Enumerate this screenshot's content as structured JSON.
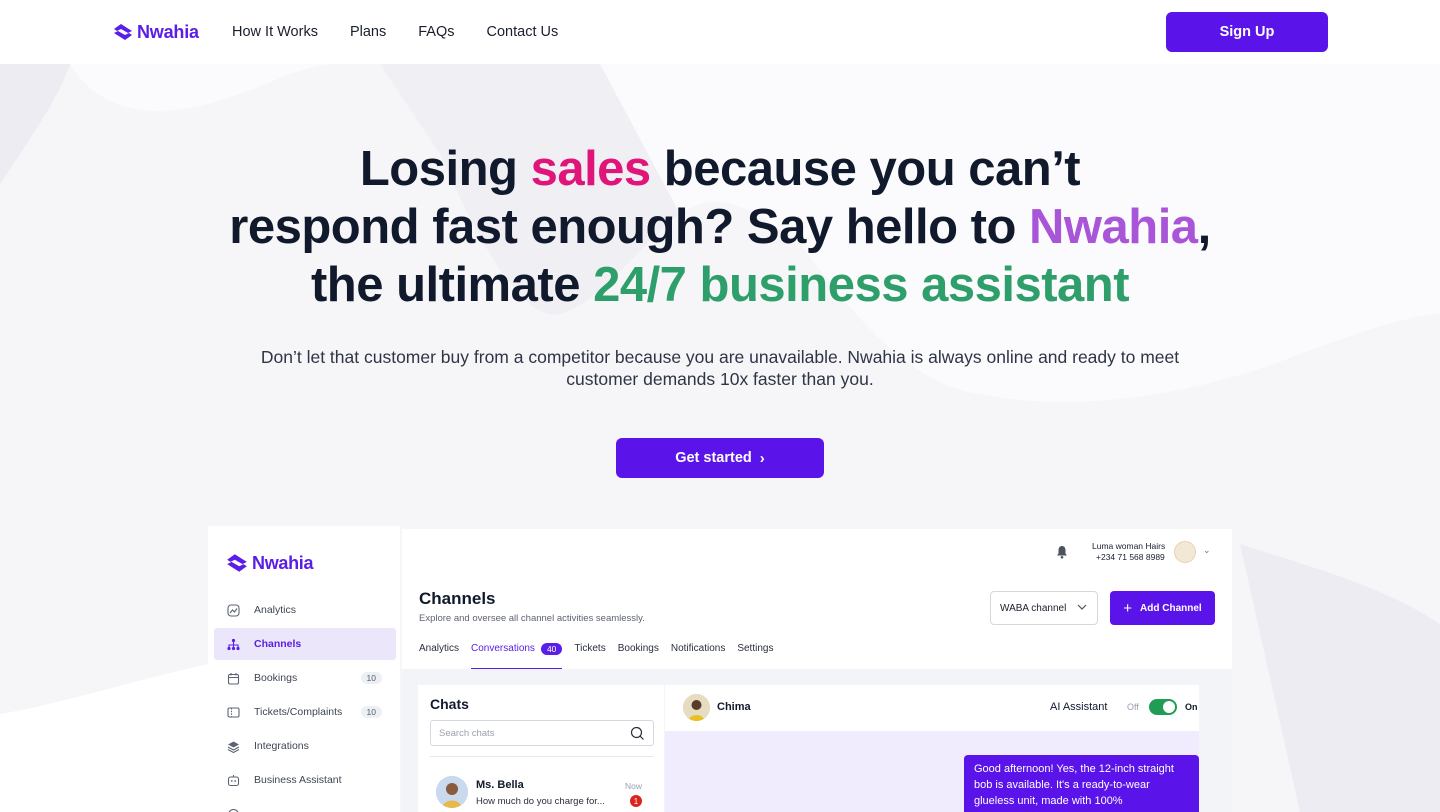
{
  "nav": {
    "brand": "Nwahia",
    "links": [
      "How It Works",
      "Plans",
      "FAQs",
      "Contact Us"
    ],
    "signup_label": "Sign Up"
  },
  "hero": {
    "headline_part1": "Losing ",
    "headline_highlight1": "sales",
    "headline_part2": " because you can’t",
    "headline_part3": "respond fast enough? Say hello to ",
    "headline_highlight2": "Nwahia",
    "headline_part4": ",",
    "headline_part5": "the ultimate ",
    "headline_highlight3": "24/7 business assistant",
    "subtitle": "Don’t let that customer buy from a competitor because you are unavailable. Nwahia is always online and ready to meet customer demands 10x faster than you.",
    "cta_label": "Get started",
    "colors": {
      "highlight1": "#e0157a",
      "highlight2": "#a855d8",
      "highlight3": "#2e9e6a",
      "accent": "#5a14ea"
    }
  },
  "dashboard": {
    "brand": "Nwahia",
    "sidebar": {
      "items": [
        {
          "label": "Analytics",
          "icon": "analytics-icon"
        },
        {
          "label": "Channels",
          "icon": "channels-icon",
          "active": true
        },
        {
          "label": "Bookings",
          "icon": "calendar-icon",
          "count": "10"
        },
        {
          "label": "Tickets/Complaints",
          "icon": "ticket-icon",
          "count": "10"
        },
        {
          "label": "Integrations",
          "icon": "layers-icon"
        },
        {
          "label": "Business Assistant",
          "icon": "assistant-icon"
        }
      ]
    },
    "account": {
      "name": "Luma woman Hairs",
      "phone": "+234 71 568 8989"
    },
    "page_title": "Channels",
    "page_subtitle": "Explore and oversee all channel activities seamlessly.",
    "channel_select": "WABA channel",
    "add_channel_label": "Add Channel",
    "tabs": [
      {
        "label": "Analytics"
      },
      {
        "label": "Conversations",
        "badge": "40",
        "active": true
      },
      {
        "label": "Tickets"
      },
      {
        "label": "Bookings"
      },
      {
        "label": "Notifications"
      },
      {
        "label": "Settings"
      }
    ],
    "chats": {
      "title": "Chats",
      "search_placeholder": "Search chats",
      "items": [
        {
          "name": "Ms. Bella",
          "time": "Now",
          "preview": "How much do you charge for...",
          "unread": "1"
        }
      ]
    },
    "conversation": {
      "contact": "Chima",
      "ai_label": "AI Assistant",
      "off_label": "Off",
      "on_label": "On",
      "message": "Good afternoon! Yes, the 12-inch straight bob is available. It's a ready-to-wear glueless unit, made with 100%"
    }
  }
}
